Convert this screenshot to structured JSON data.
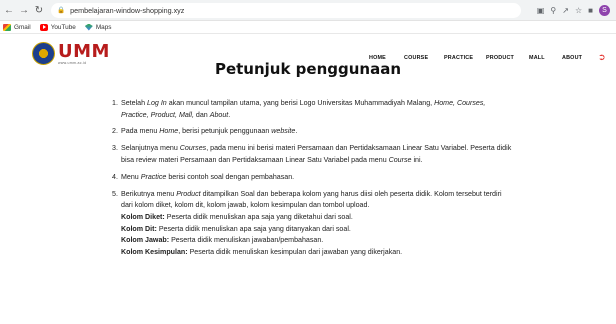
{
  "browser": {
    "url": "pembelajaran-window-shopping.xyz",
    "profile_initial": "S",
    "bookmarks": [
      {
        "label": "Gmail",
        "icon": "gmail-icon"
      },
      {
        "label": "YouTube",
        "icon": "youtube-icon"
      },
      {
        "label": "Maps",
        "icon": "maps-icon"
      }
    ]
  },
  "site": {
    "logo_text": "UMM",
    "logo_url": "www.umm.ac.id",
    "menu": [
      "HOME",
      "COURSE",
      "PRACTICE",
      "PRODUCT",
      "MALL",
      "ABOUT"
    ],
    "accent_color": "#b71c1c"
  },
  "content": {
    "title": "Petunjuk penggunaan",
    "items": [
      {
        "num": "1.",
        "parts": [
          "Setelah ",
          "Log In",
          " akan muncul tampilan utama, yang berisi Logo Universitas Muhammadiyah Malang, ",
          "Home, Courses, Practice, Product, Mall,",
          " dan ",
          "About",
          "."
        ]
      },
      {
        "num": "2.",
        "parts": [
          "Pada menu ",
          "Home",
          ", berisi petunjuk penggunaan ",
          "website",
          "."
        ]
      },
      {
        "num": "3.",
        "parts": [
          "Selanjutnya menu ",
          "Courses",
          ", pada menu ini berisi materi Persamaan dan Pertidaksamaan Linear Satu Variabel. Peserta didik bisa review materi Persamaan dan Pertidaksamaan Linear Satu Variabel pada menu ",
          "Course",
          " ini."
        ]
      },
      {
        "num": "4.",
        "parts": [
          "Menu ",
          "Practice",
          " berisi contoh soal dengan pembahasan."
        ]
      },
      {
        "num": "5.",
        "parts": [
          "Berikutnya menu ",
          "Product",
          " ditampilkan Soal dan beberapa kolom yang harus diisi oleh peserta didik. Kolom tersebut terdiri dari kolom diket, kolom dit, kolom jawab, kolom kesimpulan dan tombol upload."
        ],
        "details": [
          {
            "label": "Kolom Diket:",
            "text": " Peserta didik menuliskan apa saja yang diketahui dari soal."
          },
          {
            "label": "Kolom Dit:",
            "text": " Peserta didik menuliskan apa saja yang ditanyakan dari soal."
          },
          {
            "label": "Kolom Jawab:",
            "text": " Peserta didik menuliskan jawaban/pembahasan."
          },
          {
            "label": "Kolom Kesimpulan:",
            "text": " Peserta didik menuliskan kesimpulan dari jawaban yang dikerjakan."
          }
        ]
      }
    ]
  }
}
